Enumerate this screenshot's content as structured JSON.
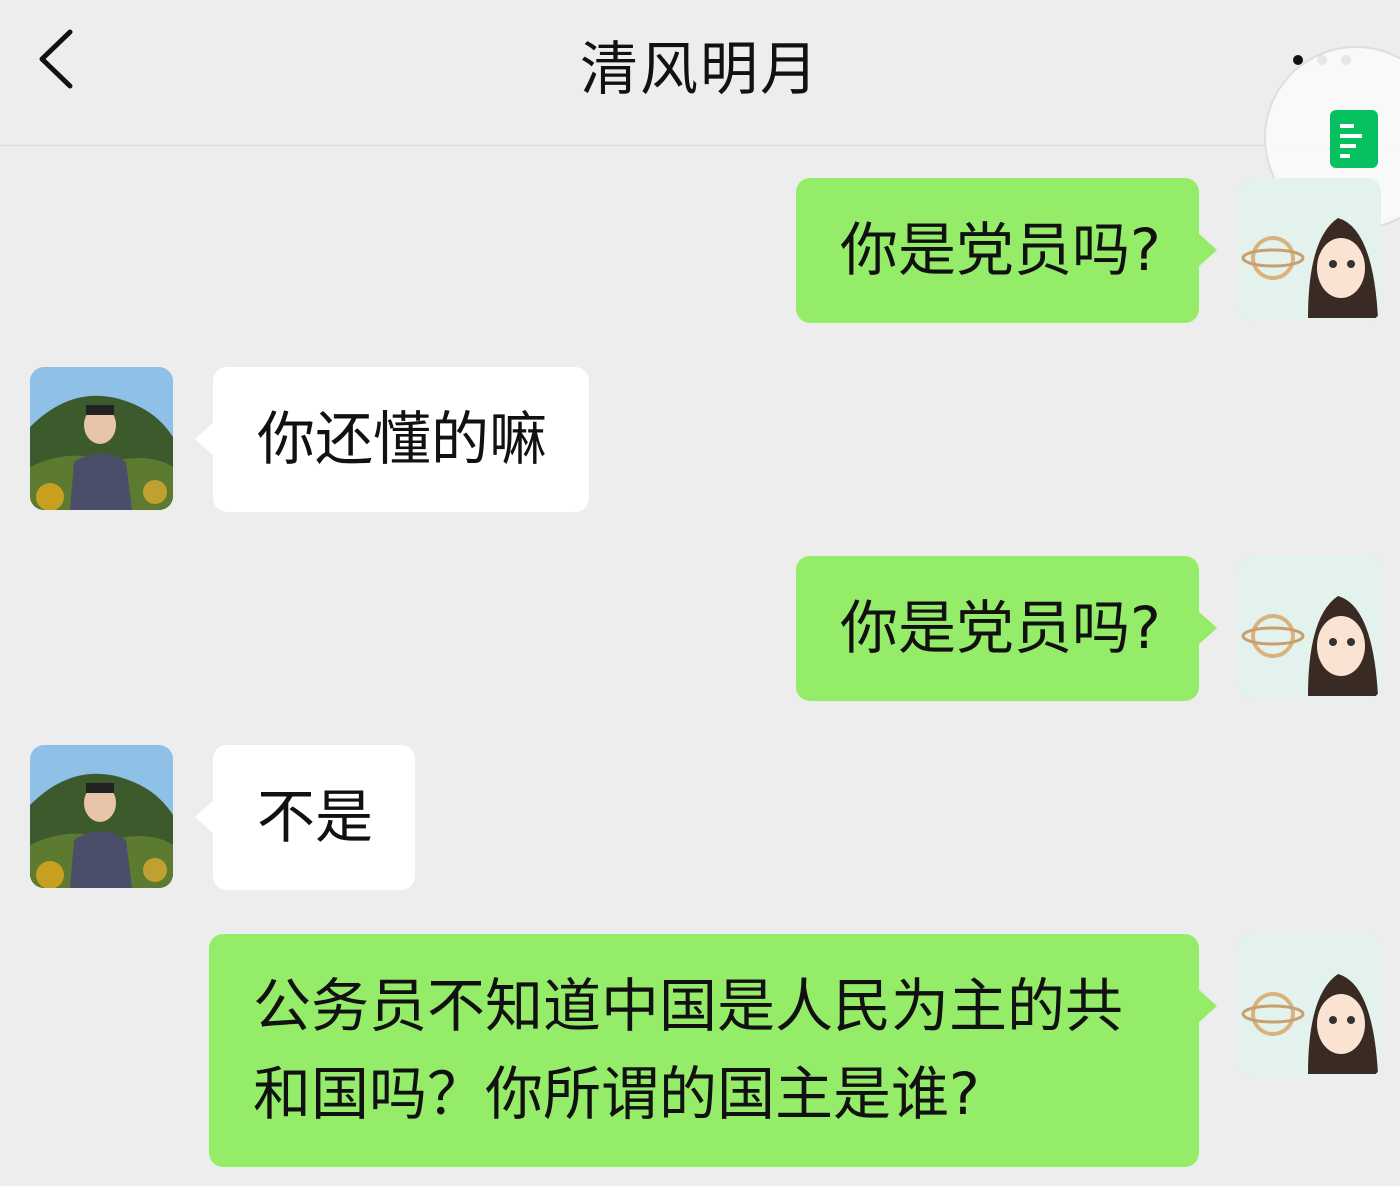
{
  "header": {
    "title": "清风明月",
    "back_icon": "chevron-left-icon",
    "more_icon": "more-dots-icon"
  },
  "floating_window": {
    "icon": "document-icon",
    "color": "#07c160"
  },
  "colors": {
    "self_bubble": "#95ec69",
    "other_bubble": "#ffffff",
    "background": "#ededed"
  },
  "messages": [
    {
      "sender": "self",
      "text": "你是党员吗?"
    },
    {
      "sender": "other",
      "text": "你还懂的嘛"
    },
    {
      "sender": "self",
      "text": "你是党员吗?"
    },
    {
      "sender": "other",
      "text": "不是"
    },
    {
      "sender": "self",
      "text": "公务员不知道中国是人民为主的共和国吗？你所谓的国主是谁?"
    }
  ]
}
